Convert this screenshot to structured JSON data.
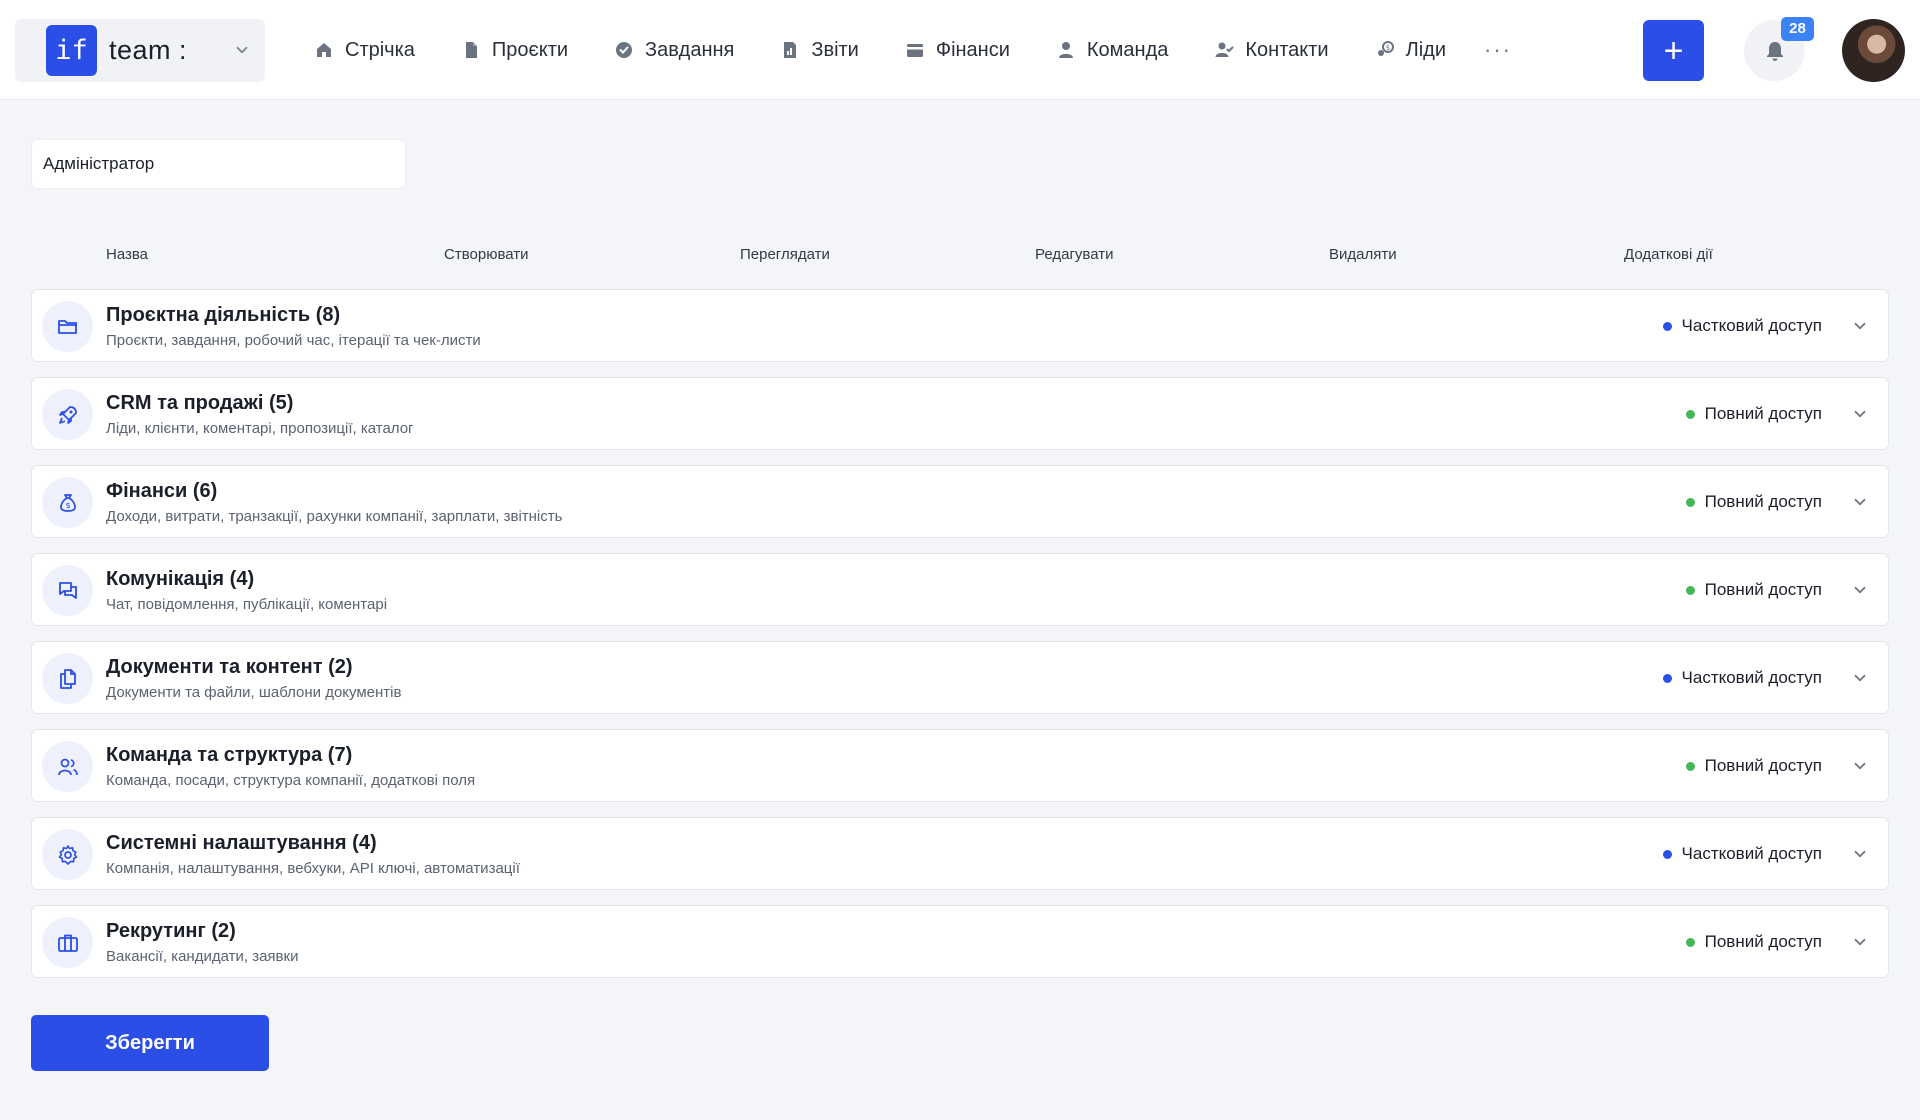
{
  "colors": {
    "accent": "#2a4ee6",
    "partial": "#2a4ee6",
    "full": "#43b75a",
    "badge": "#3b82f6"
  },
  "header": {
    "logo_text": "if",
    "workspace_name": "team :",
    "nav": [
      {
        "label": "Стрічка",
        "icon": "home-icon"
      },
      {
        "label": "Проєкти",
        "icon": "document-icon"
      },
      {
        "label": "Завдання",
        "icon": "check-circle-icon"
      },
      {
        "label": "Звіти",
        "icon": "report-icon"
      },
      {
        "label": "Фінанси",
        "icon": "wallet-icon"
      },
      {
        "label": "Команда",
        "icon": "user-icon"
      },
      {
        "label": "Контакти",
        "icon": "contacts-icon"
      },
      {
        "label": "Ліди",
        "icon": "leads-icon"
      }
    ],
    "more_label": "···",
    "add_label": "+",
    "notifications_count": "28"
  },
  "role": {
    "value": "Адміністратор"
  },
  "columns": {
    "name": "Назва",
    "create": "Створювати",
    "view": "Переглядати",
    "edit": "Редагувати",
    "delete": "Видаляти",
    "extra": "Додаткові дії"
  },
  "modules": [
    {
      "title": "Проєктна діяльність (8)",
      "desc": "Проєкти, завдання, робочий час, ітерації та чек-листи",
      "status": "Частковий доступ",
      "access": "partial",
      "icon": "folder-icon"
    },
    {
      "title": "CRM та продажі (5)",
      "desc": "Ліди, клієнти, коментарі, пропозиції, каталог",
      "status": "Повний доступ",
      "access": "full",
      "icon": "rocket-icon"
    },
    {
      "title": "Фінанси (6)",
      "desc": "Доходи, витрати, транзакції, рахунки компанії, зарплати, звітність",
      "status": "Повний доступ",
      "access": "full",
      "icon": "money-bag-icon"
    },
    {
      "title": "Комунікація (4)",
      "desc": "Чат, повідомлення, публікації, коментарі",
      "status": "Повний доступ",
      "access": "full",
      "icon": "chat-icon"
    },
    {
      "title": "Документи та контент (2)",
      "desc": "Документи та файли, шаблони документів",
      "status": "Частковий доступ",
      "access": "partial",
      "icon": "documents-icon"
    },
    {
      "title": "Команда та структура (7)",
      "desc": "Команда, посади, структура компанії, додаткові поля",
      "status": "Повний доступ",
      "access": "full",
      "icon": "team-icon"
    },
    {
      "title": "Системні налаштування (4)",
      "desc": "Компанія, налаштування, вебхуки, API ключі, автоматизації",
      "status": "Частковий доступ",
      "access": "partial",
      "icon": "gear-icon"
    },
    {
      "title": "Рекрутинг (2)",
      "desc": "Вакансії, кандидати, заявки",
      "status": "Повний доступ",
      "access": "full",
      "icon": "briefcase-icon"
    }
  ],
  "save_label": "Зберегти"
}
